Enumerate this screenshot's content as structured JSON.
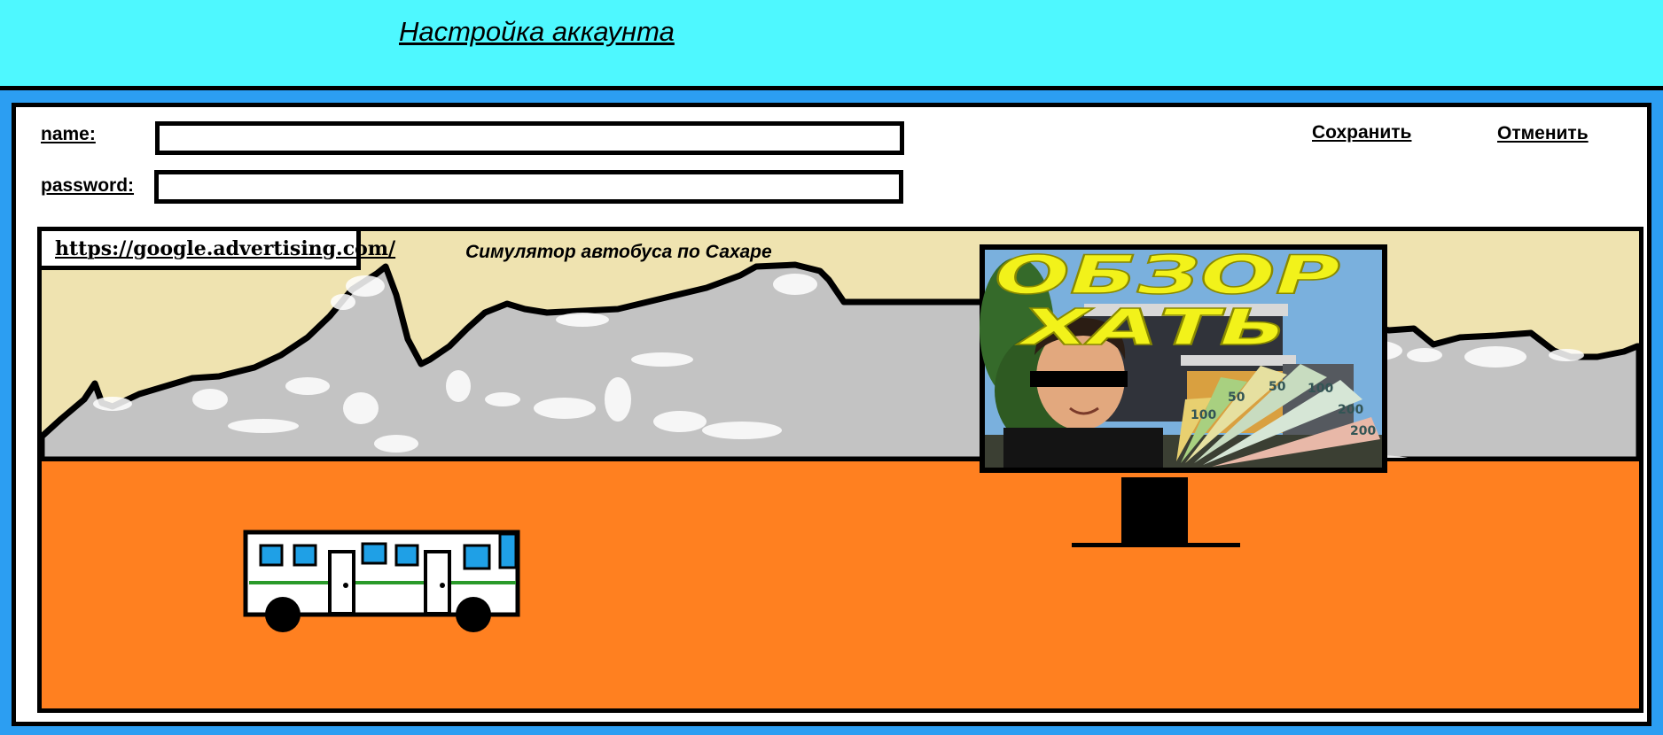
{
  "header": {
    "title": "Настройка аккаунта"
  },
  "form": {
    "name_label": "name:",
    "name_value": "",
    "password_label": "password:",
    "password_value": ""
  },
  "actions": {
    "save_label": "Сохранить",
    "cancel_label": "Отменить"
  },
  "ad": {
    "url": "https://google.advertising.com/",
    "title": "Симулятор автобуса по Сахаре",
    "billboard_line1": "ОБЗОР",
    "billboard_line2": "ХАТЬ",
    "banknote_labels": [
      "100",
      "50",
      "50",
      "100",
      "200",
      "200"
    ]
  },
  "colors": {
    "header_bg": "#4ef8ff",
    "frame_bg": "#2c9ef2",
    "sky": "#efe3b0",
    "mountains": "#c3c3c3",
    "desert": "#ff8020",
    "bus_windows": "#1fa0e6",
    "bus_stripe": "#2a9a2a"
  }
}
